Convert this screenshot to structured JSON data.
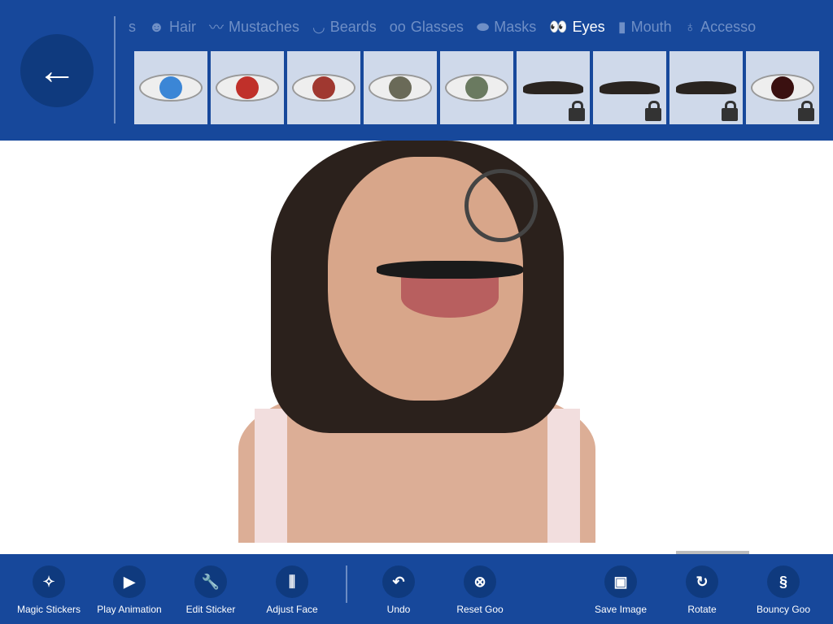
{
  "header": {
    "back_icon": "arrow-left-icon"
  },
  "tabs": [
    {
      "label": "s",
      "icon": ""
    },
    {
      "label": "Hair",
      "icon": "☻"
    },
    {
      "label": "Mustaches",
      "icon": "〰"
    },
    {
      "label": "Beards",
      "icon": "◡"
    },
    {
      "label": "Glasses",
      "icon": "oo"
    },
    {
      "label": "Masks",
      "icon": "⬬"
    },
    {
      "label": "Eyes",
      "icon": "👀"
    },
    {
      "label": "Mouth",
      "icon": "▮"
    },
    {
      "label": "Accesso",
      "icon": "♁"
    }
  ],
  "active_tab": "Eyes",
  "tiles": [
    {
      "kind": "eye",
      "iris": "#3b86d6",
      "locked": false
    },
    {
      "kind": "eye",
      "iris": "#c0302a",
      "locked": false
    },
    {
      "kind": "eye",
      "iris": "#a03830",
      "locked": false
    },
    {
      "kind": "eye",
      "iris": "#6a6a58",
      "locked": false
    },
    {
      "kind": "eye",
      "iris": "#6a7a60",
      "locked": false
    },
    {
      "kind": "brow",
      "locked": true
    },
    {
      "kind": "brow",
      "locked": true
    },
    {
      "kind": "brow",
      "locked": true
    },
    {
      "kind": "eye",
      "iris": "#3a1010",
      "locked": true
    }
  ],
  "toolbar": {
    "magic": "Magic Stickers",
    "play": "Play Animation",
    "edit": "Edit Sticker",
    "adjust": "Adjust Face",
    "undo": "Undo",
    "reset": "Reset Goo",
    "save": "Save Image",
    "rotate": "Rotate",
    "bouncy": "Bouncy Goo"
  }
}
